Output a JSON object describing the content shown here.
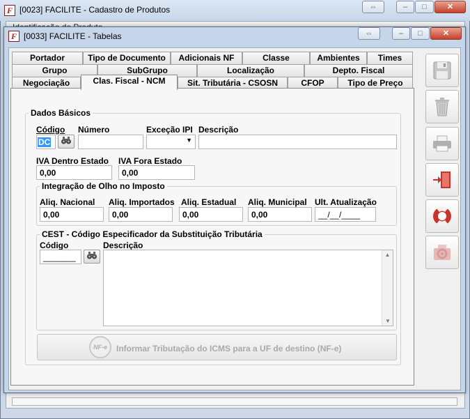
{
  "outer_window": {
    "title": "[0023] FACILITE - Cadastro de Produtos",
    "hidden_label": "Identificação do Produto"
  },
  "inner_window": {
    "title": "[0033] FACILITE - Tabelas"
  },
  "tabs": {
    "row1": [
      "Portador",
      "Tipo de Documento",
      "Adicionais NF",
      "Classe",
      "Ambientes",
      "Times"
    ],
    "row2": [
      "Grupo",
      "SubGrupo",
      "Localização",
      "Depto. Fiscal"
    ],
    "row3": [
      "Negociação",
      "Clas. Fiscal - NCM",
      "Sit. Tributária - CSOSN",
      "CFOP",
      "Tipo de Preço"
    ],
    "active": "Clas. Fiscal - NCM"
  },
  "dados_basicos": {
    "title": "Dados Básicos",
    "codigo_label": "Código",
    "codigo_value": "DC",
    "numero_label": "Número",
    "numero_value": "",
    "excecao_label": "Exceção IPI",
    "excecao_value": "",
    "descricao_label": "Descrição",
    "descricao_value": "",
    "iva_dentro_label": "IVA Dentro Estado",
    "iva_dentro_value": "0,00",
    "iva_fora_label": "IVA Fora Estado",
    "iva_fora_value": "0,00"
  },
  "olho_imposto": {
    "title": "Integração de Olho no Imposto",
    "nacional_label": "Aliq. Nacional",
    "nacional_value": "0,00",
    "importados_label": "Aliq. Importados",
    "importados_value": "0,00",
    "estadual_label": "Aliq. Estadual",
    "estadual_value": "0,00",
    "municipal_label": "Aliq. Municipal",
    "municipal_value": "0,00",
    "atualizacao_label": "Ult. Atualização",
    "atualizacao_value": "__/__/____"
  },
  "cest": {
    "title": "CEST - Código Especificador da Substituição Tributária",
    "codigo_label": "Código",
    "codigo_value": "_______",
    "descricao_label": "Descrição",
    "descricao_value": ""
  },
  "icms_button": {
    "label": "Informar Tributação do ICMS para a UF de destino (NF-e)",
    "badge": "NF-e"
  },
  "sidebar_icons": [
    "save-icon",
    "trash-icon",
    "print-icon",
    "exit-icon",
    "help-lifebuoy-icon",
    "settings-icon"
  ],
  "colors": {
    "exit_red": "#c8342c",
    "lifebuoy_red": "#c8342c",
    "selection_blue": "#3399ff"
  }
}
